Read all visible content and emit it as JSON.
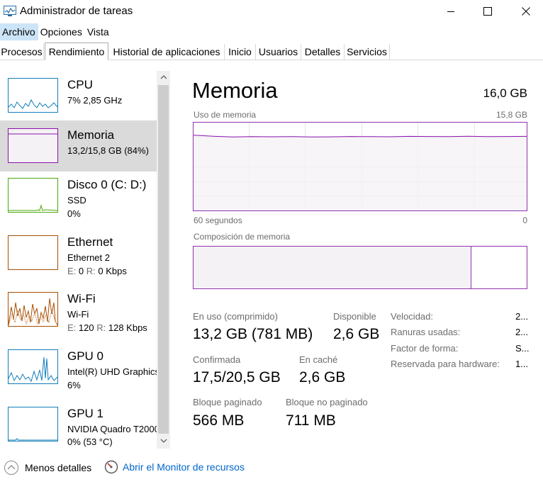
{
  "window": {
    "title": "Administrador de tareas"
  },
  "menu": [
    "Archivo",
    "Opciones",
    "Vista"
  ],
  "tabs": [
    "Procesos",
    "Rendimiento",
    "Historial de aplicaciones",
    "Inicio",
    "Usuarios",
    "Detalles",
    "Servicios"
  ],
  "selected_tab": "Rendimiento",
  "sidebar": [
    {
      "title": "CPU",
      "line1": "7%  2,85 GHz",
      "color": "#117dbb"
    },
    {
      "title": "Memoria",
      "line1": "13,2/15,8 GB (84%)",
      "color": "#8b12ae"
    },
    {
      "title": "Disco 0 (C: D:)",
      "line1": "SSD",
      "line2": "0%",
      "color": "#4da60c"
    },
    {
      "title": "Ethernet",
      "line1": "Ethernet 2",
      "line2_lbl1": "E:",
      "line2_v1": "0",
      "line2_lbl2": "R:",
      "line2_v2": "0 Kbps",
      "color": "#a74f01"
    },
    {
      "title": "Wi-Fi",
      "line1": "Wi-Fi",
      "line2_lbl1": "E:",
      "line2_v1": "120",
      "line2_lbl2": "R:",
      "line2_v2": "128 Kbps",
      "color": "#a74f01"
    },
    {
      "title": "GPU 0",
      "line1": "Intel(R) UHD Graphics",
      "line2": "6%",
      "color": "#117dbb"
    },
    {
      "title": "GPU 1",
      "line1": "NVIDIA Quadro T2000",
      "line2": "0% (53 °C)",
      "color": "#117dbb"
    }
  ],
  "main": {
    "title": "Memoria",
    "total": "16,0 GB",
    "usage_label": "Uso de memoria",
    "usage_max": "15,8 GB",
    "time_left": "60 segundos",
    "time_right": "0",
    "composition_label": "Composición de memoria",
    "usage_fraction": 0.84,
    "composition_used_fraction": 0.834,
    "stats": {
      "in_use_label": "En uso (comprimido)",
      "in_use_value": "13,2 GB (781 MB)",
      "available_label": "Disponible",
      "available_value": "2,6 GB",
      "committed_label": "Confirmada",
      "committed_value": "17,5/20,5 GB",
      "cached_label": "En caché",
      "cached_value": "2,6 GB",
      "paged_label": "Bloque paginado",
      "paged_value": "566 MB",
      "nonpaged_label": "Bloque no paginado",
      "nonpaged_value": "711 MB"
    },
    "properties": [
      {
        "label": "Velocidad:",
        "value": "2..."
      },
      {
        "label": "Ranuras usadas:",
        "value": "2..."
      },
      {
        "label": "Factor de forma:",
        "value": "S..."
      },
      {
        "label": "Reservada para hardware:",
        "value": "1..."
      }
    ],
    "accent_color": "#8b12ae"
  },
  "footer": {
    "less_details": "Menos detalles",
    "resource_monitor": "Abrir el Monitor de recursos"
  }
}
